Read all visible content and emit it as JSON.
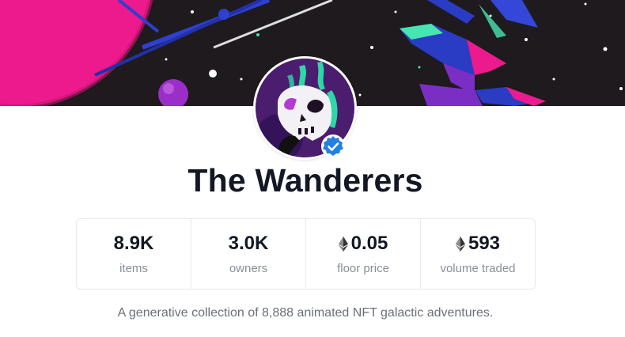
{
  "collection": {
    "name": "The Wanderers",
    "verified": true,
    "description": "A generative collection of 8,888 animated NFT galactic adventures."
  },
  "stats": [
    {
      "value": "8.9K",
      "label": "items",
      "eth_icon": false
    },
    {
      "value": "3.0K",
      "label": "owners",
      "eth_icon": false
    },
    {
      "value": "0.05",
      "label": "floor price",
      "eth_icon": true
    },
    {
      "value": "593",
      "label": "volume traded",
      "eth_icon": true
    }
  ],
  "icons": {
    "avatar": "skull-avatar-icon",
    "verified": "verified-badge-icon",
    "currency": "ethereum-icon"
  },
  "colors": {
    "banner_bg": "#1e1a1d",
    "planet_pink": "#ec1a8c",
    "accent_blue": "#2f6fe0",
    "verified_blue": "#2081e2",
    "title_text": "#141824",
    "muted_text": "#8a8f98"
  }
}
